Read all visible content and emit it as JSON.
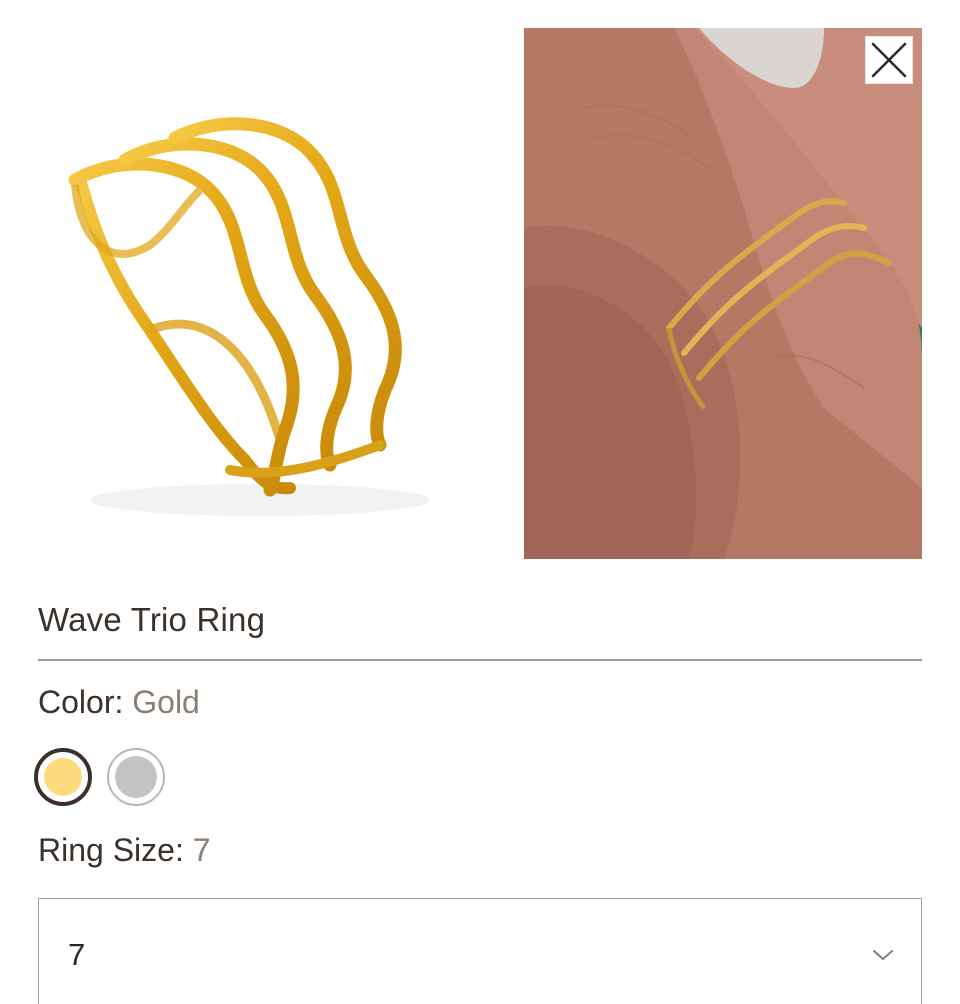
{
  "product": {
    "title": "Wave Trio Ring"
  },
  "color": {
    "label": "Color:",
    "selected": "Gold",
    "options": [
      {
        "name": "Gold",
        "hex": "#fddc7e"
      },
      {
        "name": "Silver",
        "hex": "#c4c4c4"
      }
    ]
  },
  "ring_size": {
    "label": "Ring Size:",
    "selected": "7"
  },
  "size_select": {
    "value": "7"
  },
  "icons": {
    "close": "close-icon",
    "dropdown": "chevron-down-icon"
  },
  "colors": {
    "text": "#3b302a",
    "muted": "#8a7e74",
    "border": "#a59a90",
    "gold": "#e8b21a",
    "background_teal": "#2f7a66"
  }
}
